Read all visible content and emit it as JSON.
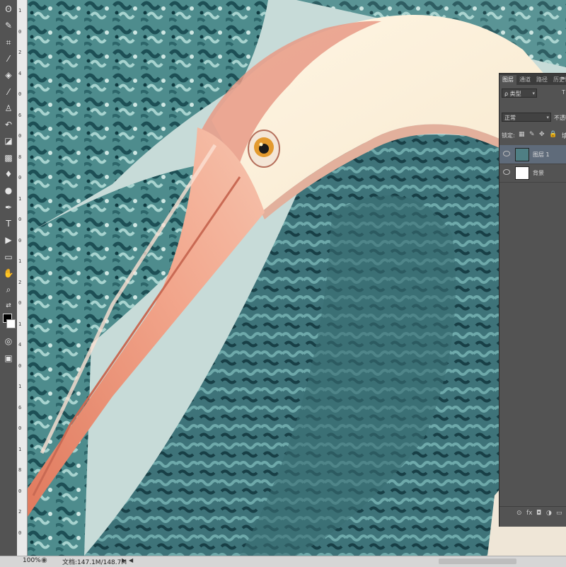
{
  "toolbar": {
    "tools": [
      {
        "icon": "lasso-icon",
        "glyph": "ʘ"
      },
      {
        "icon": "quick-selection-icon",
        "glyph": "✎"
      },
      {
        "icon": "crop-icon",
        "glyph": "⌗"
      },
      {
        "icon": "eyedropper-icon",
        "glyph": "⁄"
      },
      {
        "icon": "healing-brush-icon",
        "glyph": "◈"
      },
      {
        "icon": "brush-icon",
        "glyph": "⁄"
      },
      {
        "icon": "clone-stamp-icon",
        "glyph": "♙"
      },
      {
        "icon": "history-brush-icon",
        "glyph": "↶"
      },
      {
        "icon": "eraser-icon",
        "glyph": "◪"
      },
      {
        "icon": "gradient-icon",
        "glyph": "▩"
      },
      {
        "icon": "blur-icon",
        "glyph": "♦"
      },
      {
        "icon": "dodge-icon",
        "glyph": "●"
      },
      {
        "icon": "pen-icon",
        "glyph": "✒"
      },
      {
        "icon": "type-icon",
        "glyph": "T"
      },
      {
        "icon": "path-selection-icon",
        "glyph": "▶"
      },
      {
        "icon": "rectangle-shape-icon",
        "glyph": "▭"
      },
      {
        "icon": "hand-icon",
        "glyph": "✋"
      },
      {
        "icon": "zoom-icon",
        "glyph": "⌕"
      }
    ],
    "extra": [
      {
        "icon": "quick-mask-icon",
        "glyph": "◎"
      },
      {
        "icon": "screen-mode-icon",
        "glyph": "▣"
      }
    ]
  },
  "ruler": {
    "numbers": [
      "1",
      "0",
      "2",
      "4",
      "0",
      "6",
      "0",
      "8",
      "0",
      "1",
      "0",
      "0",
      "1",
      "2",
      "0",
      "1",
      "4",
      "0",
      "1",
      "6",
      "0",
      "1",
      "8",
      "0",
      "2",
      "0"
    ]
  },
  "status": {
    "zoom": "100%",
    "doc_size": "文档:147.1M/148.7M",
    "arrow_right": "▶",
    "arrow_left": "◀"
  },
  "panel": {
    "tabs": [
      "图层",
      "通道",
      "路径",
      "历史记"
    ],
    "menu_glyph": "≡",
    "filter_kind": "ρ 类型",
    "filter_icon": "T",
    "blend_mode": "正常",
    "opacity_label": "不透明",
    "lock_label": "锁定:",
    "lock_icons": [
      "▦",
      "✎",
      "✥",
      "🔒"
    ],
    "lock_fill": "填",
    "layers": [
      {
        "name": "图层 1",
        "selected": true,
        "thumb": "#4f7f84"
      },
      {
        "name": "背景",
        "selected": false,
        "thumb": "#ffffff"
      }
    ],
    "footer_icons": [
      "⊙",
      "fx",
      "◘",
      "◑",
      "▭",
      "▣",
      "🗑"
    ]
  }
}
